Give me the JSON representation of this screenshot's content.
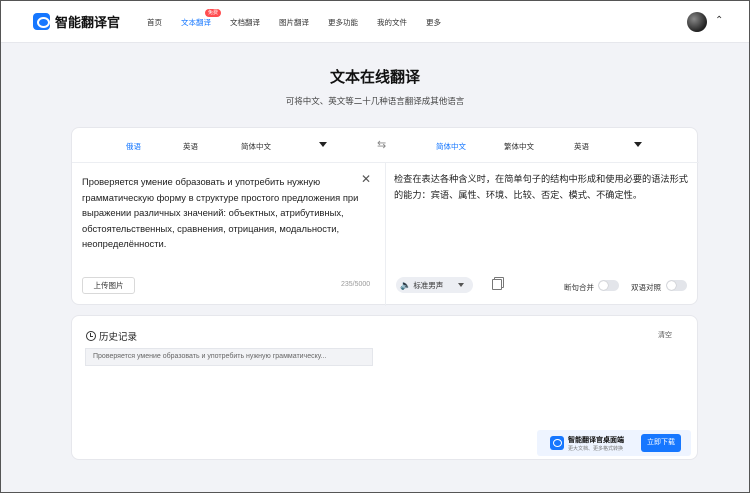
{
  "app": {
    "name": "智能翻译官"
  },
  "nav": {
    "items": [
      {
        "label": "首页"
      },
      {
        "label": "文本翻译",
        "badge": "免费"
      },
      {
        "label": "文档翻译"
      },
      {
        "label": "图片翻译"
      },
      {
        "label": "更多功能"
      },
      {
        "label": "我的文件"
      },
      {
        "label": "更多"
      }
    ]
  },
  "page": {
    "title": "文本在线翻译",
    "subtitle": "可将中文、英文等二十几种语言翻译成其他语言"
  },
  "source": {
    "langs": [
      "俄语",
      "英语",
      "简体中文"
    ],
    "text": "Проверяется умение образовать и употребить нужную грамматическую форму в структуре простого предложения при выражении различных значений: объектных, атрибутивных, обстоятельственных, сравнения, отрицания, модальности, неопределённости.",
    "upload_label": "上传图片",
    "count": "235/5000"
  },
  "target": {
    "langs": [
      "简体中文",
      "繁体中文",
      "英语"
    ],
    "text": "检查在表达各种含义时，在简单句子的结构中形成和使用必要的语法形式的能力：宾语、属性、环境、比较、否定、模式、不确定性。",
    "voice_label": "标准男声",
    "toggle_merge": "断句合并",
    "toggle_compare": "双语对照"
  },
  "history": {
    "title": "历史记录",
    "clear_label": "清空",
    "items": [
      "Проверяется умение образовать и употребить нужную грамматическу..."
    ]
  },
  "promo": {
    "title": "智能翻译官桌面端",
    "subtitle": "更大文档、更多格式转换",
    "button": "立即下载"
  },
  "colors": {
    "accent": "#1677ff",
    "badge": "#ff4d4f"
  }
}
